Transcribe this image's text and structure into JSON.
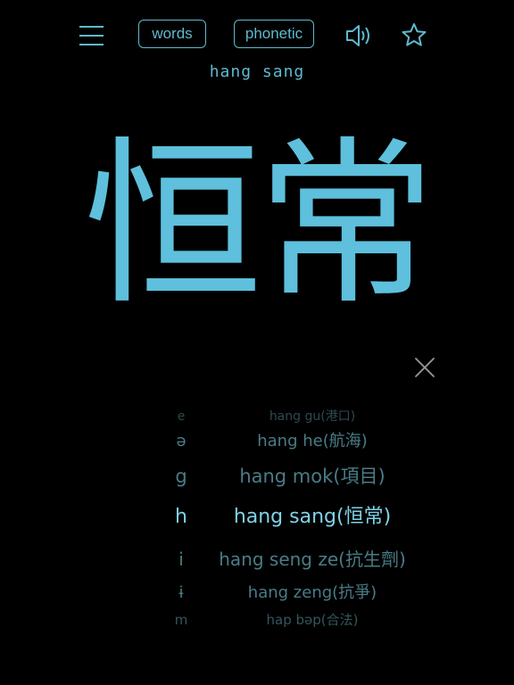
{
  "toolbar": {
    "menu_icon": "hamburger-menu-icon",
    "words_label": "words",
    "phonetic_label": "phonetic",
    "speaker_icon": "speaker-icon",
    "star_icon": "star-icon"
  },
  "romanization": "hang sang",
  "characters": "恒常",
  "close_icon": "close-icon",
  "picker": {
    "rows": [
      {
        "letter": "e",
        "word": "hang gu(港口)"
      },
      {
        "letter": "ə",
        "word": "hang he(航海)"
      },
      {
        "letter": "g",
        "word": "hang mok(項目)"
      },
      {
        "letter": "h",
        "word": "hang sang(恒常)"
      },
      {
        "letter": "i",
        "word": "hang seng ze(抗生劑)"
      },
      {
        "letter": "ɨ",
        "word": "hang zeng(抗爭)"
      },
      {
        "letter": "m",
        "word": "hap bəp(合法)"
      }
    ],
    "selected": "hang sang(恒常)"
  },
  "colors": {
    "accent": "#5fb9cf",
    "character": "#5ec0dc",
    "picker_dim": "#4a7c86",
    "picker_selected": "#7fd3e8",
    "background": "#000000"
  }
}
